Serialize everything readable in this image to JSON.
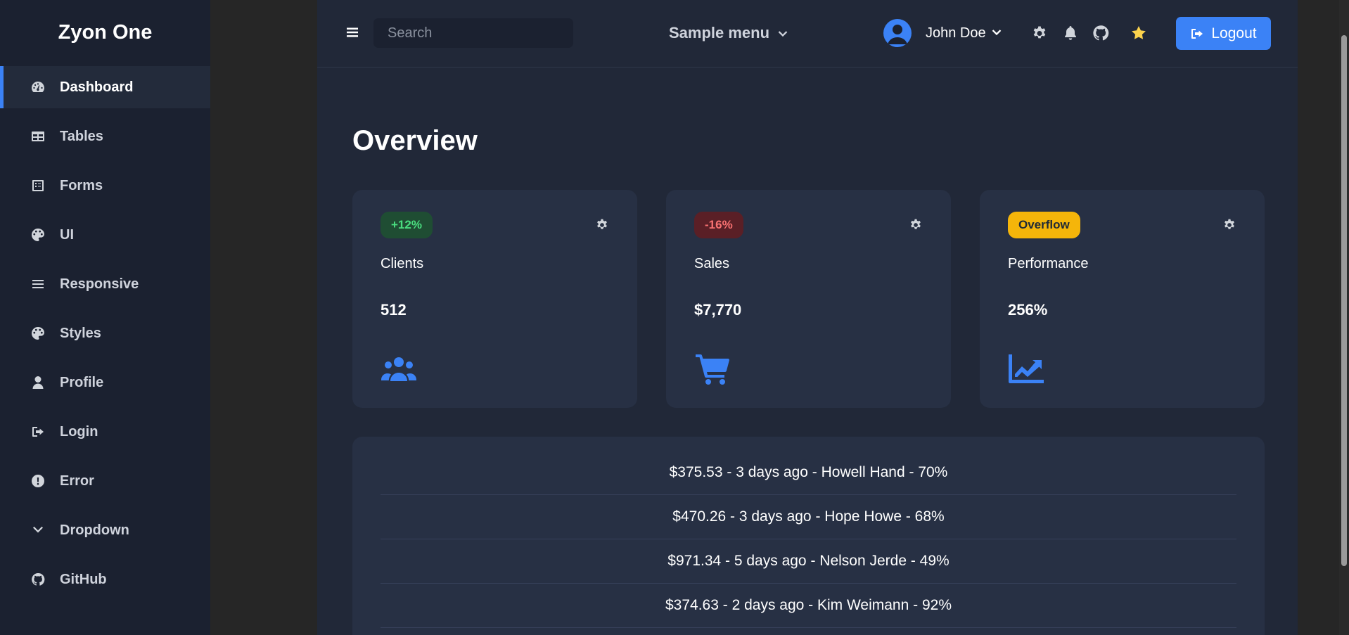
{
  "app": {
    "brand": "Zyon One"
  },
  "sidebar": {
    "items": [
      {
        "label": "Dashboard",
        "icon": "gauge-icon",
        "active": true
      },
      {
        "label": "Tables",
        "icon": "table-icon"
      },
      {
        "label": "Forms",
        "icon": "form-icon"
      },
      {
        "label": "UI",
        "icon": "palette-icon"
      },
      {
        "label": "Responsive",
        "icon": "bars-icon"
      },
      {
        "label": "Styles",
        "icon": "palette-icon"
      },
      {
        "label": "Profile",
        "icon": "user-icon"
      },
      {
        "label": "Login",
        "icon": "login-icon"
      },
      {
        "label": "Error",
        "icon": "exclamation-circle-icon"
      },
      {
        "label": "Dropdown",
        "icon": "chevron-down-icon"
      },
      {
        "label": "GitHub",
        "icon": "github-icon"
      }
    ]
  },
  "topbar": {
    "search_placeholder": "Search",
    "sample_menu": "Sample menu",
    "user_name": "John Doe",
    "logout_label": "Logout"
  },
  "main": {
    "title": "Overview",
    "cards": [
      {
        "badge": "+12%",
        "badge_color": "#1f4d33",
        "label": "Clients",
        "value": "512",
        "icon": "users-icon"
      },
      {
        "badge": "-16%",
        "badge_color": "#5a1f26",
        "label": "Sales",
        "value": "$7,770",
        "icon": "cart-icon"
      },
      {
        "badge": "Overflow",
        "badge_color": "#f5b50a",
        "label": "Performance",
        "value": "256%",
        "icon": "chart-line-icon"
      }
    ],
    "transactions": [
      "$375.53 - 3 days ago - Howell Hand - 70%",
      "$470.26 - 3 days ago - Hope Howe - 68%",
      "$971.34 - 5 days ago - Nelson Jerde - 49%",
      "$374.63 - 2 days ago - Kim Weimann - 92%"
    ]
  },
  "colors": {
    "accent": "#3b82f6",
    "sidebar_bg": "#1b2130",
    "main_bg": "#212838",
    "card_bg": "#273044"
  }
}
